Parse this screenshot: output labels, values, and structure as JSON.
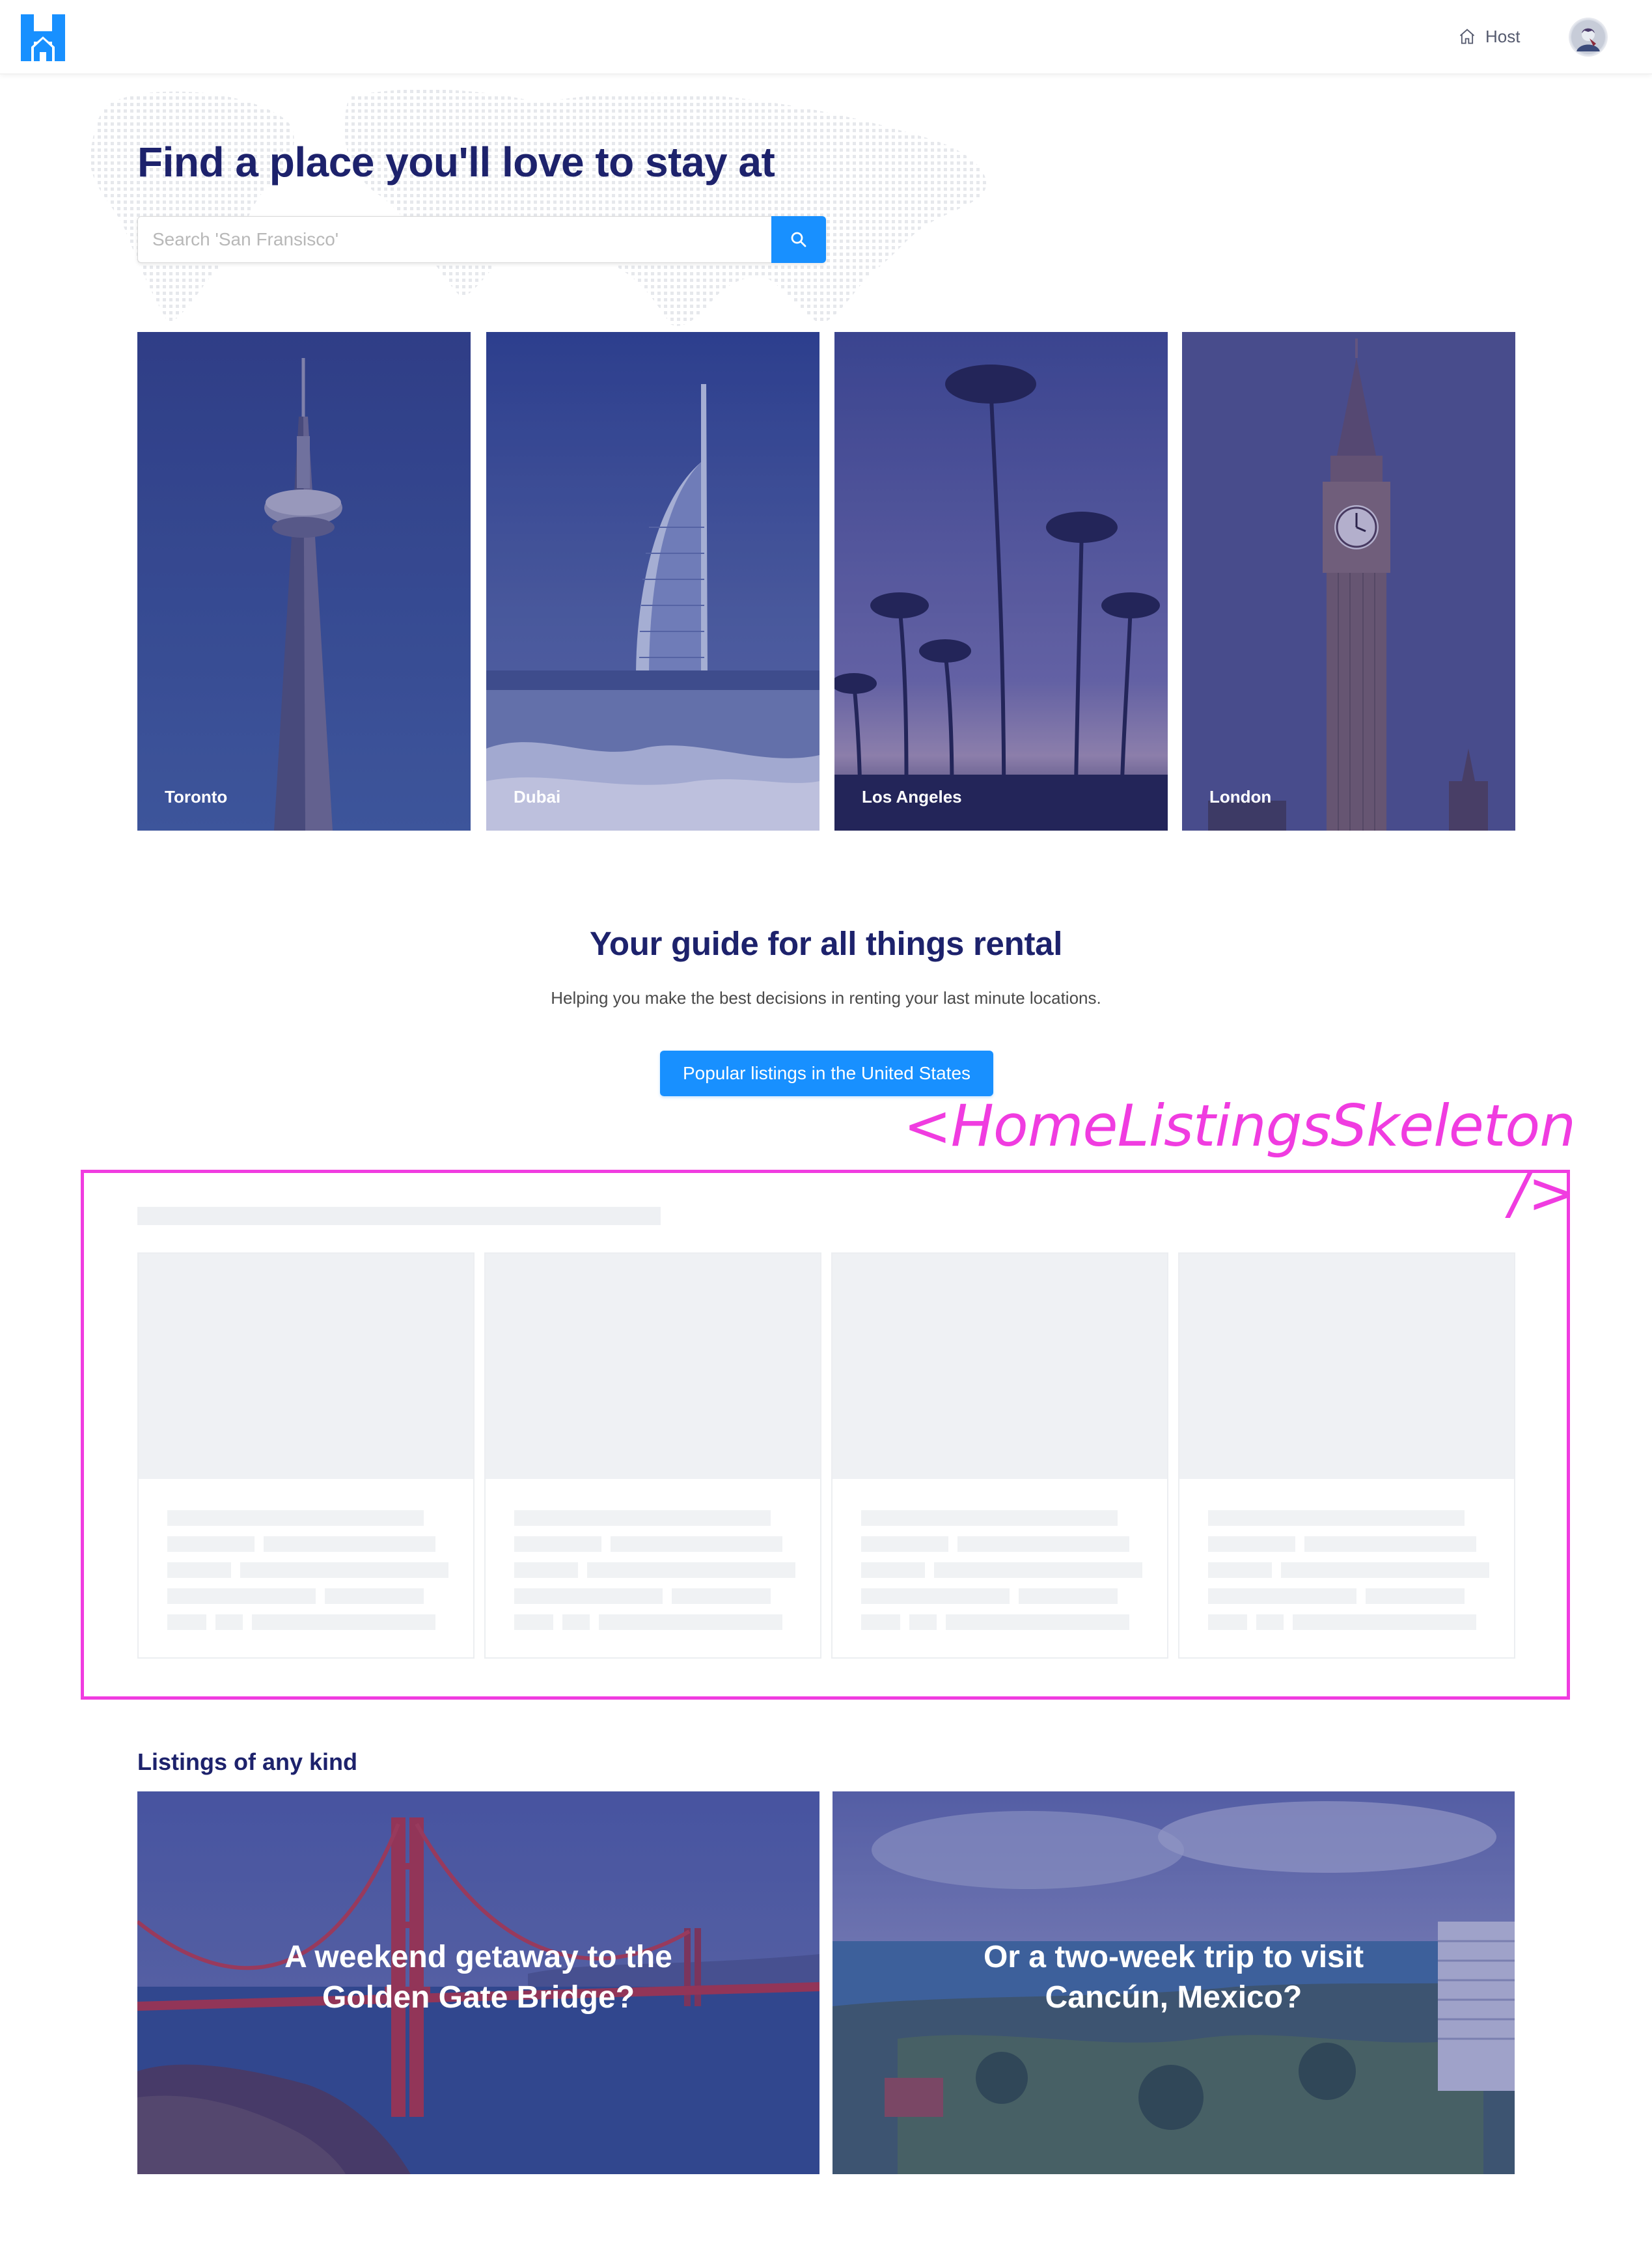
{
  "header": {
    "logo_icon": "house-h-logo-icon",
    "host_icon": "home-icon",
    "host_label": "Host",
    "avatar": "user-avatar"
  },
  "hero": {
    "title": "Find a place you'll love to stay at",
    "search": {
      "placeholder": "Search 'San Fransisco'",
      "value": "",
      "button_icon": "search-icon"
    },
    "cities": [
      {
        "label": "Toronto"
      },
      {
        "label": "Dubai"
      },
      {
        "label": "Los Angeles"
      },
      {
        "label": "London"
      }
    ]
  },
  "guide": {
    "title": "Your guide for all things rental",
    "subtitle": "Helping you make the best decisions in renting your last minute locations.",
    "button_label": "Popular listings in the United States"
  },
  "annotation": {
    "label": "<HomeListingsSkeleton />"
  },
  "listings_of_any_kind": {
    "title": "Listings of any kind",
    "cards": [
      {
        "line1": "A weekend getaway to the",
        "line2": "Golden Gate Bridge?"
      },
      {
        "line1": "Or a two-week trip to visit",
        "line2": "Cancún, Mexico?"
      }
    ]
  },
  "colors": {
    "primary": "#1890ff",
    "heading": "#1d226c",
    "annotation": "#f03ce0",
    "overlay": "#3a3d8f",
    "skeleton": "#eff1f4"
  }
}
